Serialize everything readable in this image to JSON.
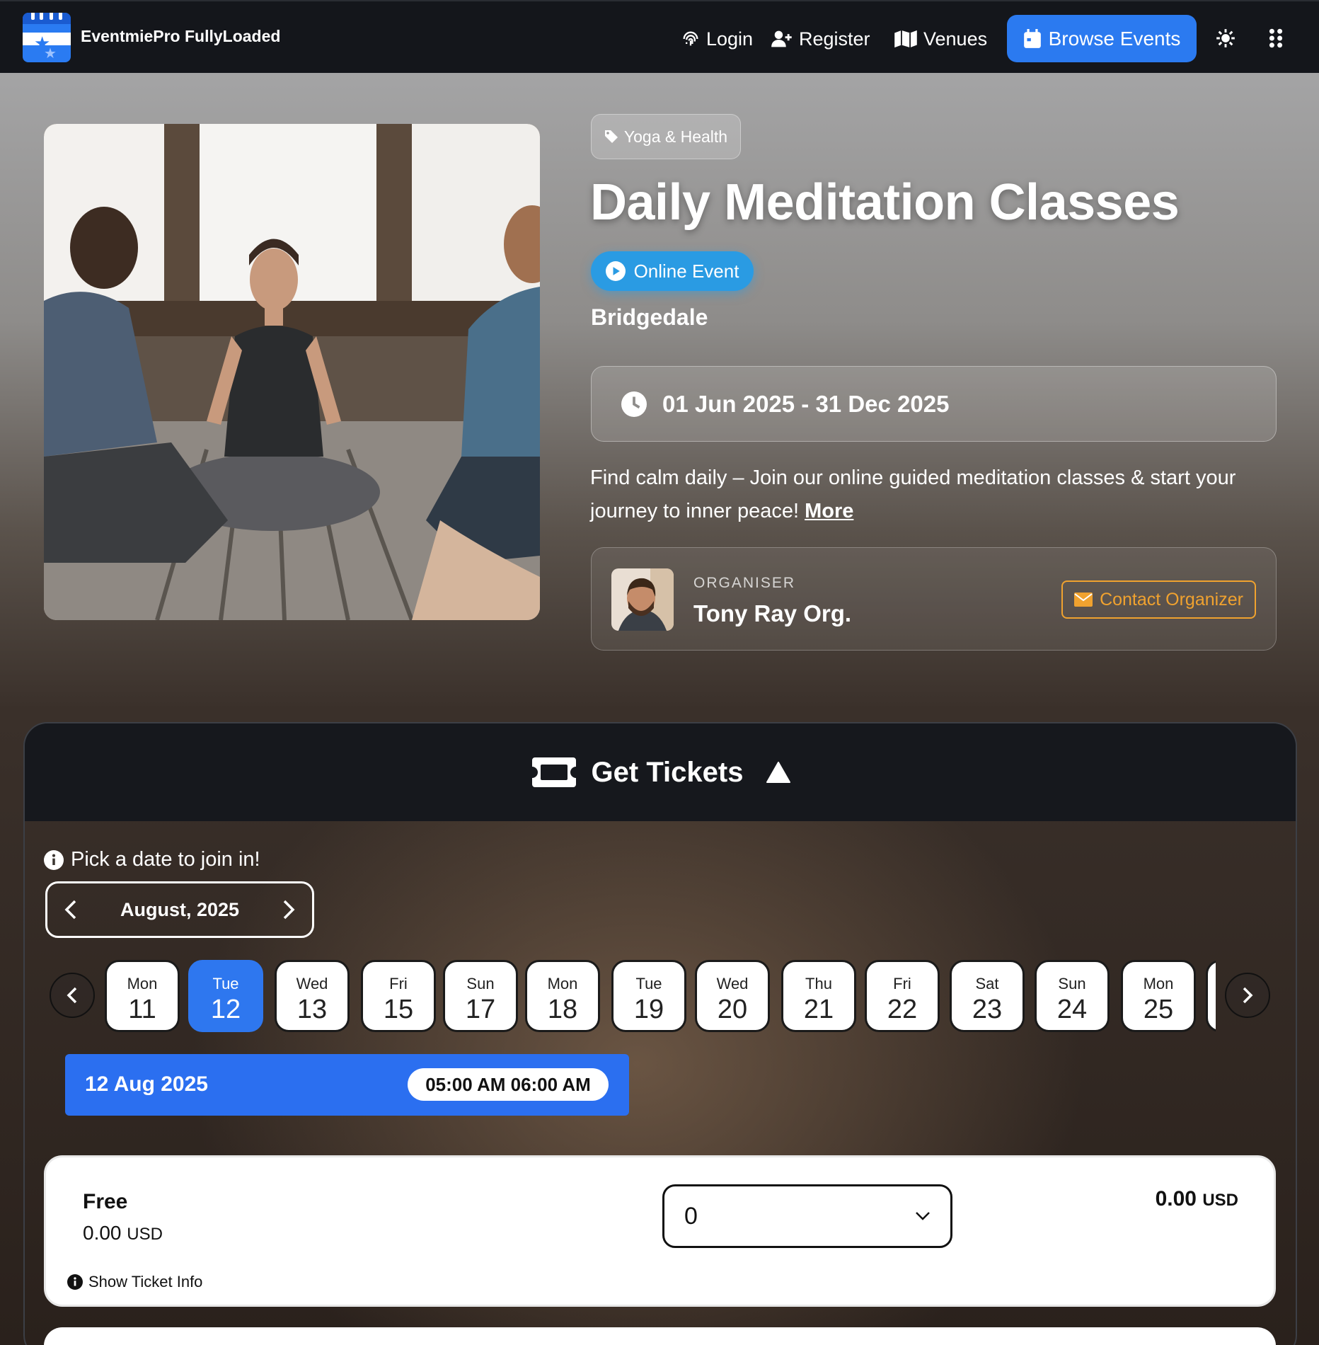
{
  "nav": {
    "brand": "EventmiePro FullyLoaded",
    "login": "Login",
    "register": "Register",
    "venues": "Venues",
    "browse_events": "Browse Events"
  },
  "event": {
    "category": "Yoga & Health",
    "title": "Daily Meditation Classes",
    "mode_badge": "Online Event",
    "location": "Bridgedale",
    "date_range": "01 Jun 2025 - 31 Dec 2025",
    "description": "Find calm daily – Join our online guided meditation classes & start your journey to inner peace!",
    "more_link": "More",
    "organiser_label": "ORGANISER",
    "organiser_name": "Tony Ray Org.",
    "contact_button": "Contact Organizer"
  },
  "tickets": {
    "heading": "Get Tickets",
    "pick_prompt": "Pick a date to join in!",
    "month": "August, 2025",
    "days": [
      {
        "dow": "Mon",
        "num": "11"
      },
      {
        "dow": "Tue",
        "num": "12"
      },
      {
        "dow": "Wed",
        "num": "13"
      },
      {
        "dow": "Fri",
        "num": "15"
      },
      {
        "dow": "Sun",
        "num": "17"
      },
      {
        "dow": "Mon",
        "num": "18"
      },
      {
        "dow": "Tue",
        "num": "19"
      },
      {
        "dow": "Wed",
        "num": "20"
      },
      {
        "dow": "Thu",
        "num": "21"
      },
      {
        "dow": "Fri",
        "num": "22"
      },
      {
        "dow": "Sat",
        "num": "23"
      },
      {
        "dow": "Sun",
        "num": "24"
      },
      {
        "dow": "Mon",
        "num": "25"
      }
    ],
    "selected_day_index": 1,
    "session": {
      "date": "12 Aug 2025",
      "time": "05:00 AM 06:00 AM"
    },
    "ticket": {
      "name": "Free",
      "price": "0.00",
      "price_currency": "USD",
      "quantity": "0",
      "total": "0.00",
      "total_currency": "USD",
      "info_link": "Show Ticket Info"
    }
  },
  "colors": {
    "accent": "#2b7af0",
    "online_badge": "#2a9be3",
    "contact": "#f0a22f",
    "nav_bg": "#14161b"
  }
}
